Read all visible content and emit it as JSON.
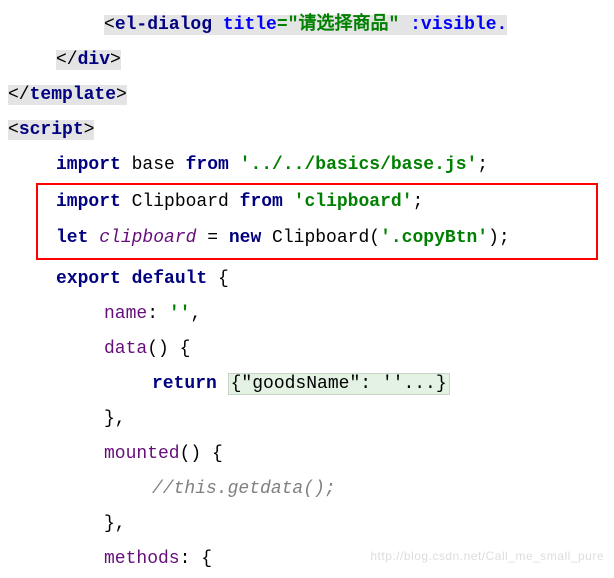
{
  "code": {
    "line1": {
      "open": "<",
      "tag": "el-dialog",
      "sp": " ",
      "attr1": "title",
      "eq1": "=",
      "val1": "\"请选择商品\"",
      "sp2": " ",
      "attr2": ":visible."
    },
    "line2": {
      "open": "</",
      "tag": "div",
      "close": ">"
    },
    "line3": {
      "open": "</",
      "tag": "template",
      "close": ">"
    },
    "line4": {
      "open": "<",
      "tag": "script",
      "close": ">"
    },
    "line5": {
      "kw1": "import",
      "id": " base ",
      "kw2": "from",
      "sp": " ",
      "str": "'../../basics/base.js'",
      "semi": ";"
    },
    "line6": {
      "kw1": "import",
      "id": " Clipboard ",
      "kw2": "from",
      "sp": " ",
      "str": "'clipboard'",
      "semi": ";"
    },
    "line7": {
      "kw1": "let",
      "sp1": " ",
      "var": "clipboard",
      "eq": " = ",
      "kw2": "new",
      "cls": " Clipboard(",
      "str": "'.copyBtn'",
      "end": ");"
    },
    "line8": {
      "kw1": "export",
      "sp": " ",
      "kw2": "default",
      "brace": " {"
    },
    "line9": {
      "prop": "name",
      "colon": ": ",
      "str": "''",
      "comma": ","
    },
    "line10": {
      "prop": "data",
      "paren": "() {"
    },
    "line11": {
      "kw": "return",
      "sp": " ",
      "fold": "{\"goodsName\": ''...}"
    },
    "line12": {
      "close": "},"
    },
    "line13": {
      "prop": "mounted",
      "paren": "() {"
    },
    "line14": {
      "comment": "//this.getdata();"
    },
    "line15": {
      "close": "},"
    },
    "line16": {
      "prop": "methods",
      "colon": ":  ",
      "brace": "{"
    }
  },
  "watermark": "http://blog.csdn.net/Call_me_small_pure"
}
